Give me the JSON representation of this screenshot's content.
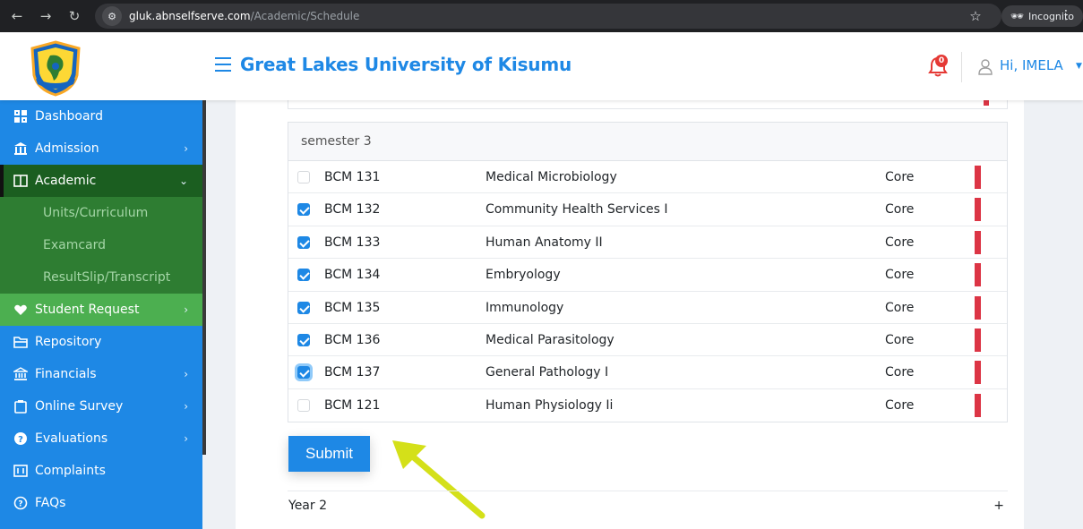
{
  "browser": {
    "url_host": "gluk.abnselfserve.com",
    "url_path": "/Academic/Schedule",
    "incognito_label": "Incognito"
  },
  "header": {
    "title": "Great Lakes University of Kisumu",
    "notification_count": "0",
    "greeting": "Hi, IMELA"
  },
  "sidebar": {
    "items": [
      {
        "label": "Dashboard",
        "icon": "dashboard-icon"
      },
      {
        "label": "Admission",
        "icon": "institution-icon"
      },
      {
        "label": "Academic",
        "icon": "book-icon"
      },
      {
        "label": "Units/Curriculum"
      },
      {
        "label": "Examcard"
      },
      {
        "label": "ResultSlip/Transcript"
      },
      {
        "label": "Student Request",
        "icon": "heart-hand-icon"
      },
      {
        "label": "Repository",
        "icon": "folder-icon"
      },
      {
        "label": "Financials",
        "icon": "bank-icon"
      },
      {
        "label": "Online Survey",
        "icon": "clipboard-icon"
      },
      {
        "label": "Evaluations",
        "icon": "question-circle-icon"
      },
      {
        "label": "Complaints",
        "icon": "complaint-icon"
      },
      {
        "label": "FAQs",
        "icon": "help-circle-icon"
      }
    ]
  },
  "semester": {
    "title": "semester 3",
    "units": [
      {
        "code": "BCM 131",
        "name": "Medical Microbiology",
        "type": "Core",
        "checked": false
      },
      {
        "code": "BCM 132",
        "name": "Community Health Services I",
        "type": "Core",
        "checked": true
      },
      {
        "code": "BCM 133",
        "name": "Human Anatomy II",
        "type": "Core",
        "checked": true
      },
      {
        "code": "BCM 134",
        "name": "Embryology",
        "type": "Core",
        "checked": true
      },
      {
        "code": "BCM 135",
        "name": "Immunology",
        "type": "Core",
        "checked": true
      },
      {
        "code": "BCM 136",
        "name": "Medical Parasitology",
        "type": "Core",
        "checked": true
      },
      {
        "code": "BCM 137",
        "name": "General Pathology I",
        "type": "Core",
        "checked": true
      },
      {
        "code": "BCM 121",
        "name": "Human Physiology Ii",
        "type": "Core",
        "checked": false
      }
    ]
  },
  "submit_label": "Submit",
  "year2": {
    "label": "Year 2",
    "toggle": "+"
  },
  "colors": {
    "primary": "#1e88e5",
    "sidebar_active": "#1b5e20",
    "marker": "#dc3545",
    "arrow": "#d4e019"
  }
}
